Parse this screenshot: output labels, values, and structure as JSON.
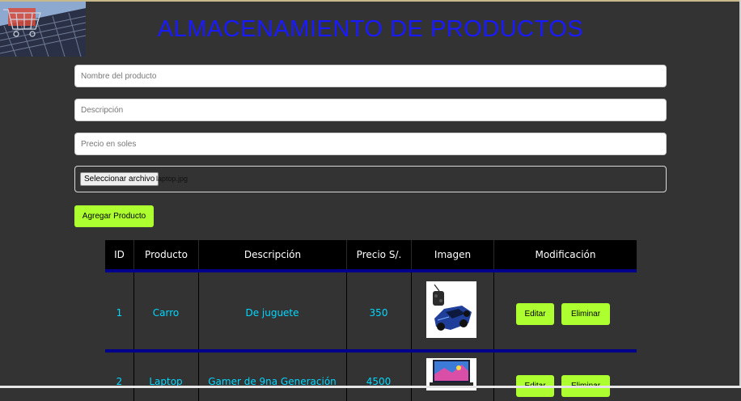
{
  "header": {
    "title": "ALMACENAMIENTO DE PRODUCTOS",
    "title_color": "#1a1aff",
    "logo_icon": "shopping-cart-on-keyboard-image"
  },
  "form": {
    "name_placeholder": "Nombre del producto",
    "description_placeholder": "Descripción",
    "price_placeholder": "Precio en soles",
    "file_button_label": "Seleccionar archivo",
    "file_name": "laptop.jpg",
    "submit_label": "Agregar Producto",
    "accent_color": "#adff2f"
  },
  "table": {
    "headers": [
      "ID",
      "Producto",
      "Descripción",
      "Precio S/.",
      "Imagen",
      "Modificación"
    ],
    "rows": [
      {
        "id": "1",
        "product": "Carro",
        "description": "De juguete",
        "price": "350",
        "image_icon": "toy-car-image",
        "edit_label": "Editar",
        "delete_label": "Eliminar"
      },
      {
        "id": "2",
        "product": "Laptop",
        "description": "Gamer de 9na Generación",
        "price": "4500",
        "image_icon": "laptop-image",
        "edit_label": "Editar",
        "delete_label": "Eliminar"
      }
    ],
    "cell_text_color": "#00d8ff",
    "separator_color": "#00008b"
  }
}
